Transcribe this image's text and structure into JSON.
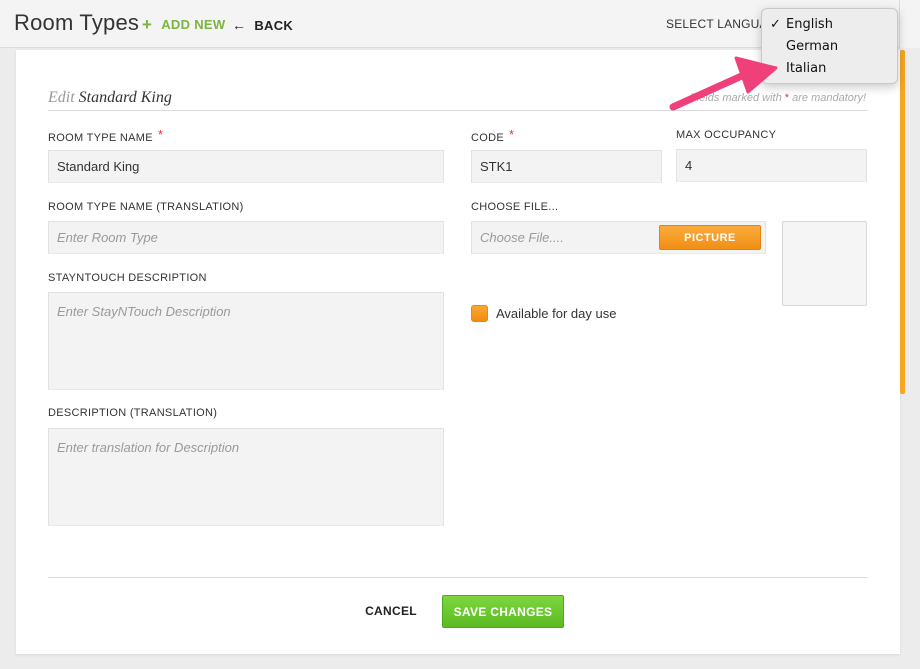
{
  "header": {
    "title": "Room Types",
    "add_new_label": "ADD NEW",
    "back_label": "BACK",
    "select_language_label": "SELECT LANGUAGE"
  },
  "language_menu": {
    "options": [
      "English",
      "German",
      "Italian"
    ],
    "selected": "English",
    "check_glyph": "✓"
  },
  "form": {
    "edit_prefix": "Edit",
    "edit_name": "Standard King",
    "mandatory_note_prefix": "Fields marked with",
    "mandatory_star": "*",
    "mandatory_note_suffix": "are mandatory!",
    "room_type_name_label": "ROOM TYPE NAME",
    "room_type_name_value": "Standard King",
    "code_label": "CODE",
    "code_value": "STK1",
    "max_occupancy_label": "MAX OCCUPANCY",
    "max_occupancy_value": "4",
    "translation_label": "ROOM TYPE NAME (TRANSLATION)",
    "translation_placeholder": "Enter Room Type",
    "choose_file_label": "CHOOSE FILE...",
    "choose_file_placeholder": "Choose File....",
    "picture_button": "PICTURE",
    "stayntouch_description_label": "STAYNTOUCH DESCRIPTION",
    "stayntouch_description_placeholder": "Enter StayNTouch Description",
    "description_translation_label": "DESCRIPTION (TRANSLATION)",
    "description_translation_placeholder": "Enter translation for Description",
    "day_use_label": "Available for day use"
  },
  "actions": {
    "cancel_label": "CANCEL",
    "save_label": "SAVE CHANGES"
  },
  "colors": {
    "accent_orange": "#f5a623",
    "save_green": "#6cc931",
    "add_new_green": "#7cb342",
    "required_red": "#e53935",
    "annotation_arrow": "#f0407a"
  }
}
